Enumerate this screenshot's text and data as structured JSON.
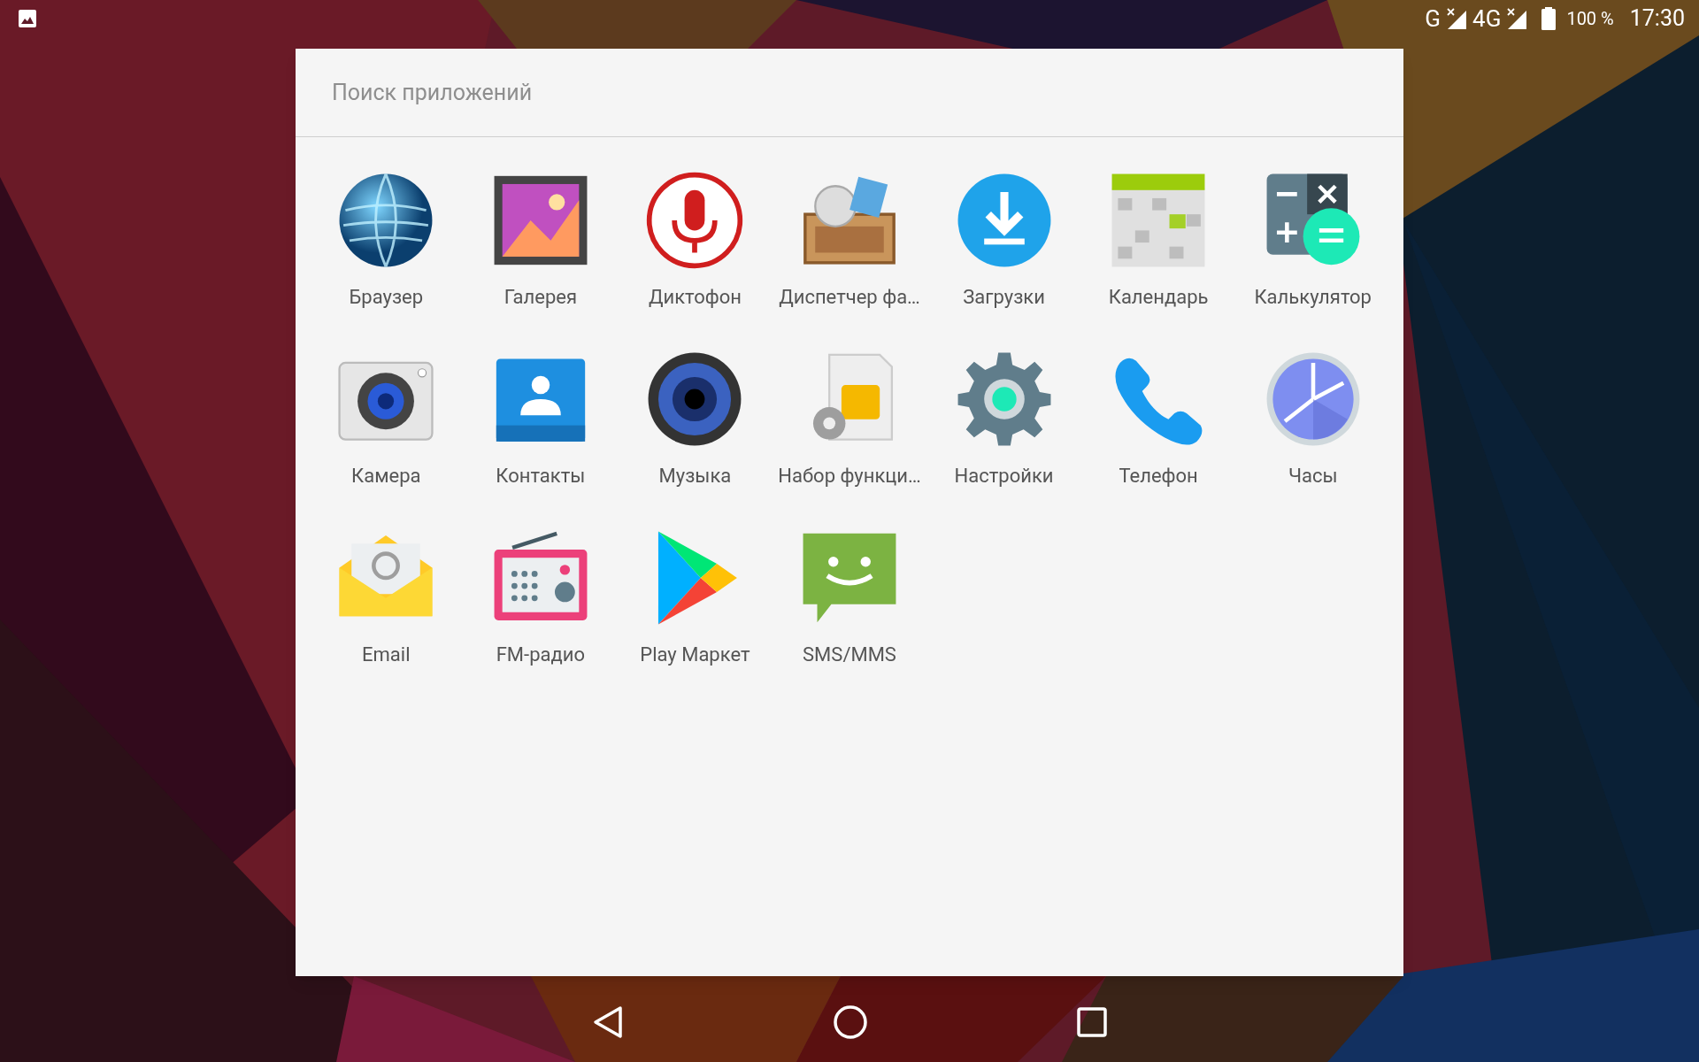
{
  "status_bar": {
    "networks": [
      {
        "label": "G"
      },
      {
        "label": "4G"
      }
    ],
    "battery": "100 %",
    "time": "17:30"
  },
  "search": {
    "placeholder": "Поиск приложений"
  },
  "apps": [
    {
      "kind": "browser",
      "label": "Браузер"
    },
    {
      "kind": "gallery",
      "label": "Галерея"
    },
    {
      "kind": "recorder",
      "label": "Диктофон"
    },
    {
      "kind": "files",
      "label": "Диспетчер фа…"
    },
    {
      "kind": "downloads",
      "label": "Загрузки"
    },
    {
      "kind": "calendar",
      "label": "Календарь"
    },
    {
      "kind": "calculator",
      "label": "Калькулятор"
    },
    {
      "kind": "camera",
      "label": "Камера"
    },
    {
      "kind": "contacts",
      "label": "Контакты"
    },
    {
      "kind": "music",
      "label": "Музыка"
    },
    {
      "kind": "simtoolkit",
      "label": "Набор функци…"
    },
    {
      "kind": "settings",
      "label": "Настройки"
    },
    {
      "kind": "phone",
      "label": "Телефон"
    },
    {
      "kind": "clock",
      "label": "Часы"
    },
    {
      "kind": "email",
      "label": "Email"
    },
    {
      "kind": "radio",
      "label": "FM-радио"
    },
    {
      "kind": "store",
      "label": "Play Маркет"
    },
    {
      "kind": "sms",
      "label": "SMS/MMS"
    }
  ]
}
